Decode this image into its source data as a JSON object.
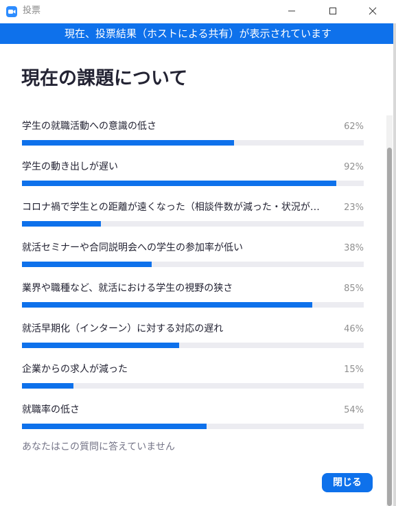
{
  "window": {
    "title": "投票",
    "icon": "zoom-video-icon",
    "controls": [
      "minimize-icon",
      "maximize-icon",
      "close-icon"
    ]
  },
  "banner": {
    "text": "現在、投票結果（ホストによる共有）が表示されています"
  },
  "poll": {
    "title": "現在の課題について",
    "options": [
      {
        "label": "学生の就職活動への意識の低さ",
        "percent": 62,
        "percent_label": "62%"
      },
      {
        "label": "学生の動き出しが遅い",
        "percent": 92,
        "percent_label": "92%"
      },
      {
        "label": "コロナ禍で学生との距離が遠くなった（相談件数が減った・状況が…",
        "percent": 23,
        "percent_label": "23%"
      },
      {
        "label": "就活セミナーや合同説明会への学生の参加率が低い",
        "percent": 38,
        "percent_label": "38%"
      },
      {
        "label": "業界や職種など、就活における学生の視野の狭さ",
        "percent": 85,
        "percent_label": "85%"
      },
      {
        "label": "就活早期化（インターン）に対する対応の遅れ",
        "percent": 46,
        "percent_label": "46%"
      },
      {
        "label": "企業からの求人が減った",
        "percent": 15,
        "percent_label": "15%"
      },
      {
        "label": "就職率の低さ",
        "percent": 54,
        "percent_label": "54%"
      }
    ],
    "status_text": "あなたはこの質問に答えていません"
  },
  "actions": {
    "close_label": "閉じる"
  },
  "colors": {
    "accent": "#0e71eb",
    "bar_track": "#ececf1",
    "title_text": "#232333",
    "muted_text": "#8f8f8f"
  }
}
